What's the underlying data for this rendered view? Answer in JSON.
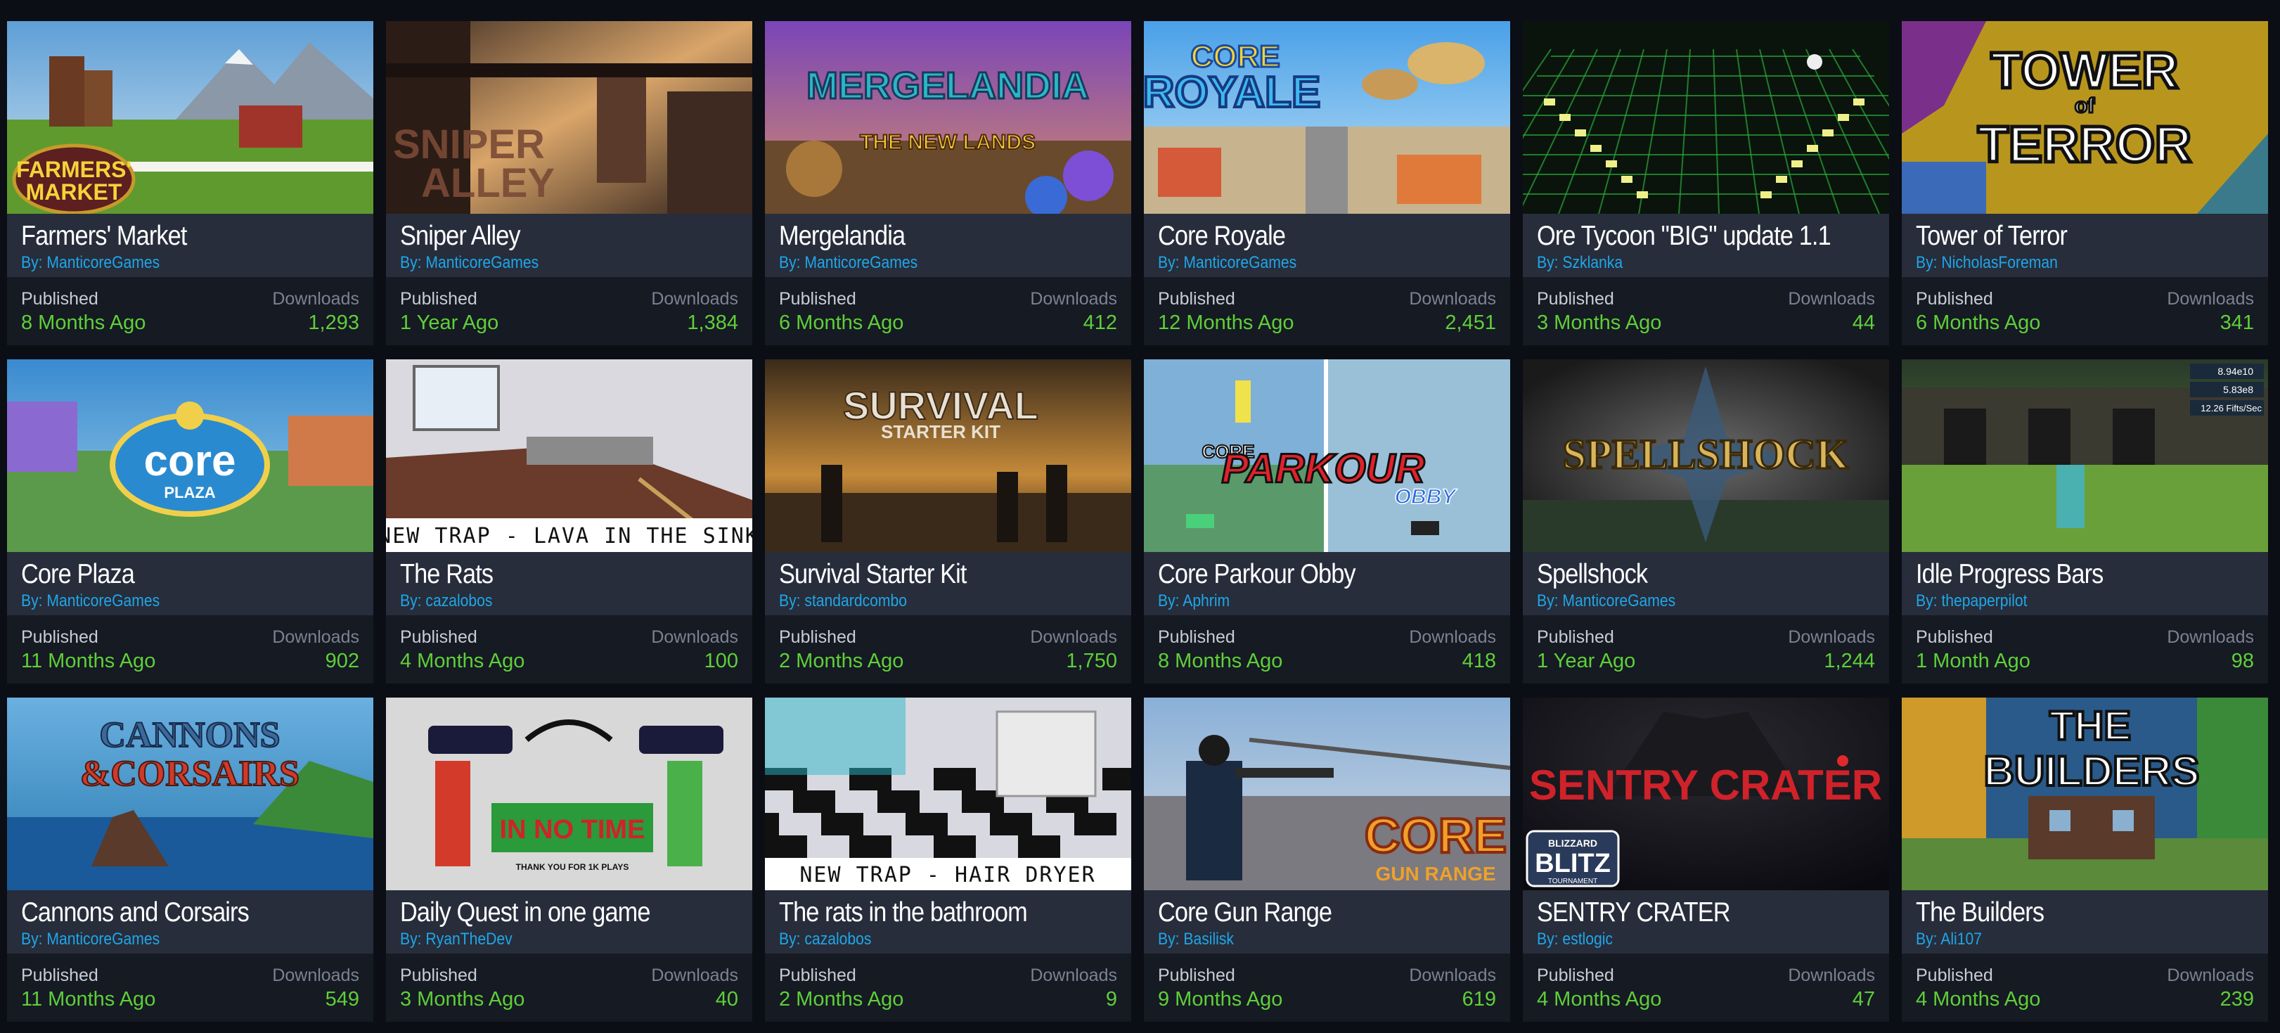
{
  "labels": {
    "by": "By: ",
    "published": "Published",
    "downloads": "Downloads"
  },
  "colors": {
    "background": "#0b0e14",
    "card_info": "#272d3b",
    "card_stats": "#151a23",
    "author_link": "#1fa6e8",
    "stat_value": "#5fcf38"
  },
  "games": [
    {
      "title": "Farmers' Market",
      "author": "ManticoreGames",
      "published": "8 Months Ago",
      "downloads": "1,293",
      "thumb_text": [
        "FARMERS'",
        "MARKET"
      ],
      "thumb_scene": "farm"
    },
    {
      "title": "Sniper Alley",
      "author": "ManticoreGames",
      "published": "1 Year Ago",
      "downloads": "1,384",
      "thumb_text": [
        "SNIPER",
        "ALLEY"
      ],
      "thumb_scene": "alley"
    },
    {
      "title": "Mergelandia",
      "author": "ManticoreGames",
      "published": "6 Months Ago",
      "downloads": "412",
      "thumb_text": [
        "MERGELANDIA",
        "THE NEW LANDS"
      ],
      "thumb_scene": "merge"
    },
    {
      "title": "Core Royale",
      "author": "ManticoreGames",
      "published": "12 Months Ago",
      "downloads": "2,451",
      "thumb_text": [
        "CORE",
        "ROYALE"
      ],
      "thumb_scene": "royale"
    },
    {
      "title": "Ore Tycoon \"BIG\" update 1.1",
      "author": "Szklanka",
      "published": "3 Months Ago",
      "downloads": "44",
      "thumb_text": [],
      "thumb_scene": "ore"
    },
    {
      "title": "Tower of Terror",
      "author": "NicholasForeman",
      "published": "6 Months Ago",
      "downloads": "341",
      "thumb_text": [
        "TOWER",
        "of",
        "TERROR"
      ],
      "thumb_scene": "tower"
    },
    {
      "title": "Core Plaza",
      "author": "ManticoreGames",
      "published": "11 Months Ago",
      "downloads": "902",
      "thumb_text": [
        "core",
        "PLAZA"
      ],
      "thumb_scene": "plaza"
    },
    {
      "title": "The Rats",
      "author": "cazalobos",
      "published": "4 Months Ago",
      "downloads": "100",
      "thumb_text": [
        "NEW TRAP - LAVA IN THE SINK"
      ],
      "thumb_scene": "rats"
    },
    {
      "title": "Survival Starter Kit",
      "author": "standardcombo",
      "published": "2 Months Ago",
      "downloads": "1,750",
      "thumb_text": [
        "SURVIVAL",
        "STARTER KIT"
      ],
      "thumb_scene": "survival"
    },
    {
      "title": "Core Parkour Obby",
      "author": "Aphrim",
      "published": "8 Months Ago",
      "downloads": "418",
      "thumb_text": [
        "CORE",
        "PARKOUR",
        "OBBY"
      ],
      "thumb_scene": "parkour"
    },
    {
      "title": "Spellshock",
      "author": "ManticoreGames",
      "published": "1 Year Ago",
      "downloads": "1,244",
      "thumb_text": [
        "SPELLSHOCK"
      ],
      "thumb_scene": "spell"
    },
    {
      "title": "Idle Progress Bars",
      "author": "thepaperpilot",
      "published": "1 Month Ago",
      "downloads": "98",
      "thumb_text": [
        "8.94e10",
        "5.83e8",
        "12.26 Fifts/Sec"
      ],
      "thumb_scene": "idle"
    },
    {
      "title": "Cannons and Corsairs",
      "author": "ManticoreGames",
      "published": "11 Months Ago",
      "downloads": "549",
      "thumb_text": [
        "CANNONS",
        "&CORSAIRS"
      ],
      "thumb_scene": "cannons"
    },
    {
      "title": "Daily Quest in one game",
      "author": "RyanTheDev",
      "published": "3 Months Ago",
      "downloads": "40",
      "thumb_text": [
        "IN NO TIME",
        "THANK YOU FOR 1K PLAYS"
      ],
      "thumb_scene": "daily"
    },
    {
      "title": "The rats in the bathroom",
      "author": "cazalobos",
      "published": "2 Months Ago",
      "downloads": "9",
      "thumb_text": [
        "NEW TRAP - HAIR DRYER"
      ],
      "thumb_scene": "bathroom"
    },
    {
      "title": "Core Gun Range",
      "author": "Basilisk",
      "published": "9 Months Ago",
      "downloads": "619",
      "thumb_text": [
        "CORE",
        "GUN RANGE"
      ],
      "thumb_scene": "gunrange"
    },
    {
      "title": "SENTRY CRATER",
      "author": "estlogic",
      "published": "4 Months Ago",
      "downloads": "47",
      "thumb_text": [
        "SENTRY CRATER",
        "BLIZZARD",
        "BLITZ",
        "TOURNAMENT"
      ],
      "thumb_scene": "sentry"
    },
    {
      "title": "The Builders",
      "author": "Ali107",
      "published": "4 Months Ago",
      "downloads": "239",
      "thumb_text": [
        "THE",
        "BUILDERS"
      ],
      "thumb_scene": "builders"
    }
  ]
}
